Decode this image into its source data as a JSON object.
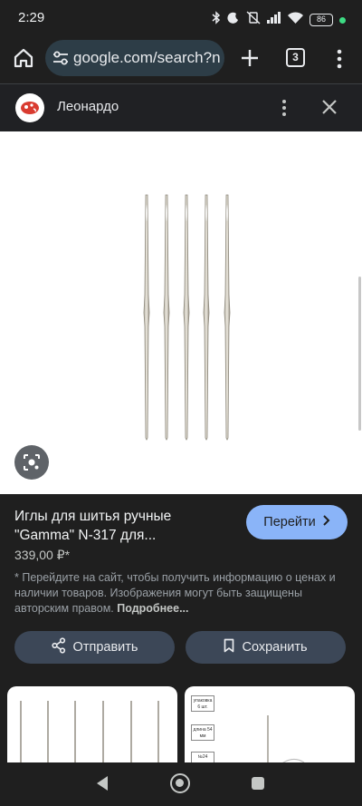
{
  "status_bar": {
    "time": "2:29",
    "battery": "86",
    "icons": [
      "bluetooth-icon",
      "do-not-disturb-icon",
      "vibrate-off-icon",
      "signal-icon",
      "wifi-icon",
      "battery-icon",
      "charging-dot-icon"
    ]
  },
  "browser": {
    "url": "google.com/search?n",
    "tab_count": "3",
    "icons": [
      "home-icon",
      "site-settings-icon",
      "new-tab-icon",
      "tabs-icon",
      "more-vert-icon"
    ]
  },
  "source": {
    "name": "Леонардо",
    "icons": [
      "source-logo-icon",
      "more-vert-icon",
      "close-icon"
    ]
  },
  "product": {
    "title": "Иглы для шитья ручные \"Gamma\" N-317 для...",
    "price": "339,00 ₽*",
    "goto_label": "Перейти",
    "disclaimer": "* Перейдите на сайт, чтобы получить информацию о ценах и наличии товаров. Изображения могут быть защищены авторским правом.",
    "more_link": "Подробнее...",
    "send_label": "Отправить",
    "save_label": "Сохранить"
  },
  "thumbnails": {
    "second": {
      "labels": [
        "упаковка 6 шт.",
        "длина 54 мм",
        "№24"
      ]
    }
  },
  "colors": {
    "background": "#1f1f1f",
    "accent": "#8ab4f8",
    "button": "#3c4757",
    "omnibox": "#2d3d47"
  }
}
